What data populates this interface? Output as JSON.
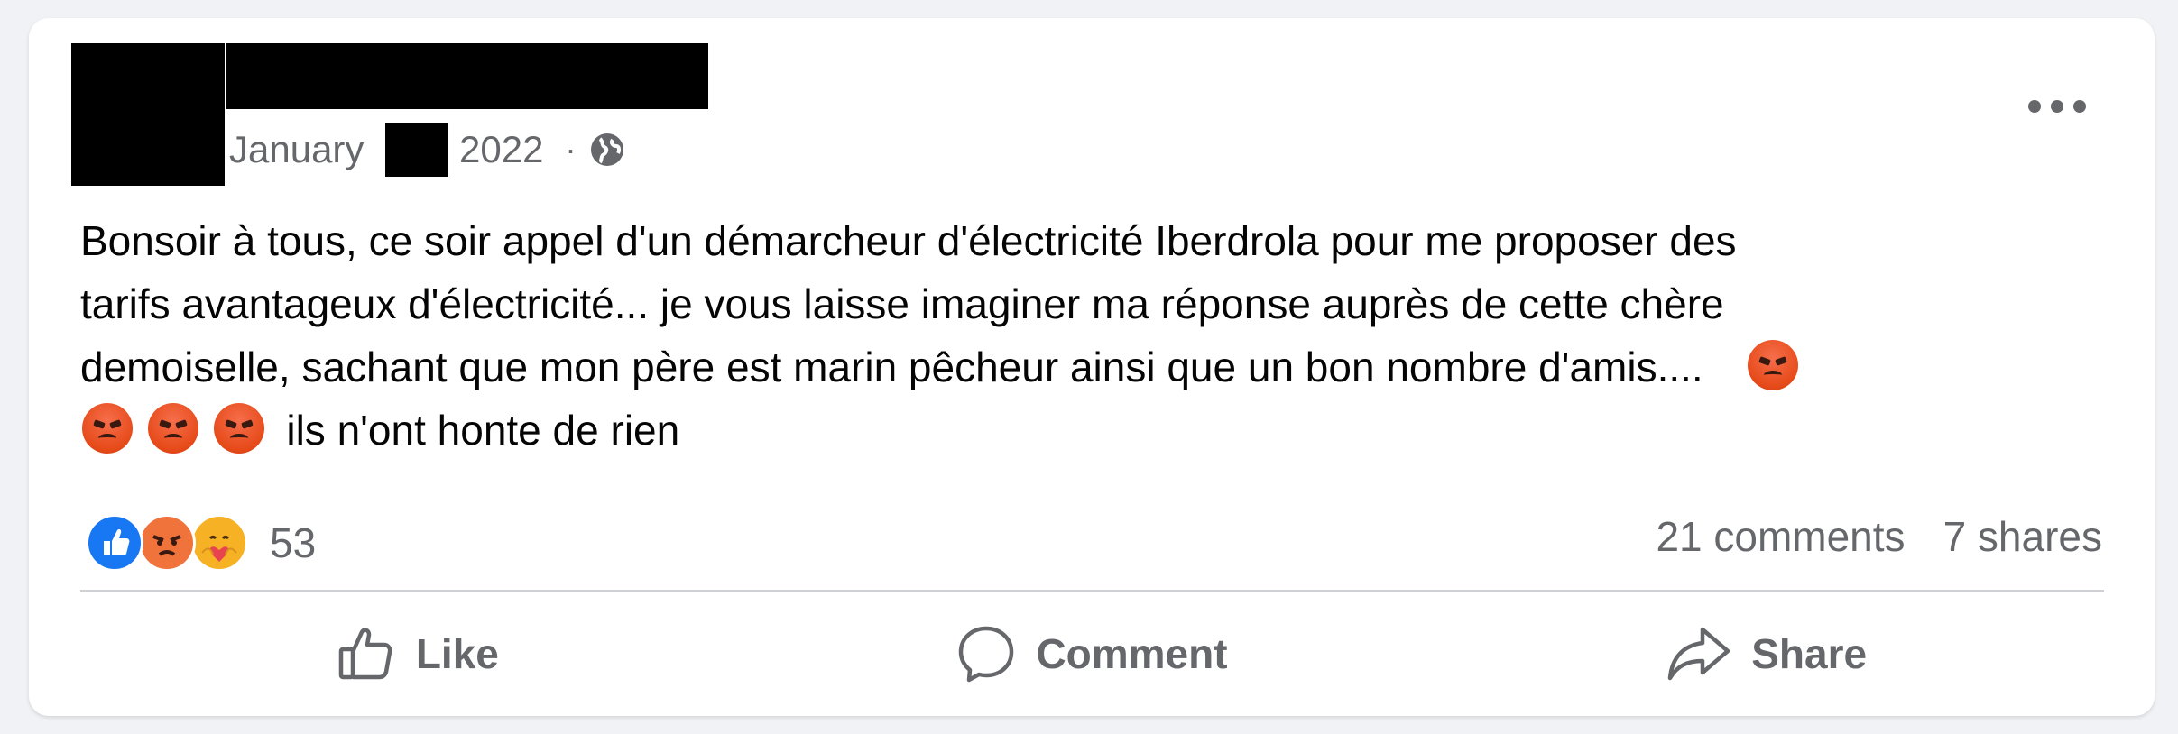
{
  "post": {
    "date_month": "January",
    "date_year": "2022",
    "separator": "·",
    "privacy_icon": "globe-icon",
    "more_icon": "more-options-icon",
    "text_line_1": "Bonsoir à tous, ce soir appel d'un démarcheur d'électricité Iberdrola pour me proposer des",
    "text_line_2": "tarifs avantageux d'électricité... je vous laisse imaginer ma réponse auprès de cette chère",
    "text_line_3": "demoiselle, sachant que mon père est marin pêcheur ainsi que un bon nombre d'amis....",
    "text_line_4": "ils n'ont honte de rien",
    "emoji": "angry-face-emoji"
  },
  "stats": {
    "reaction_icons": [
      "like-reaction-icon",
      "angry-reaction-icon",
      "care-reaction-icon"
    ],
    "reaction_count": "53",
    "comments": "21 comments",
    "shares": "7 shares"
  },
  "actions": {
    "like_label": "Like",
    "comment_label": "Comment",
    "share_label": "Share"
  },
  "colors": {
    "background": "#F0F2F5",
    "card": "#FFFFFF",
    "text": "#050505",
    "secondary_text": "#65676B",
    "like_blue": "#1877F2",
    "angry_orange": "#E64A19",
    "care_yellow": "#F7B125"
  }
}
